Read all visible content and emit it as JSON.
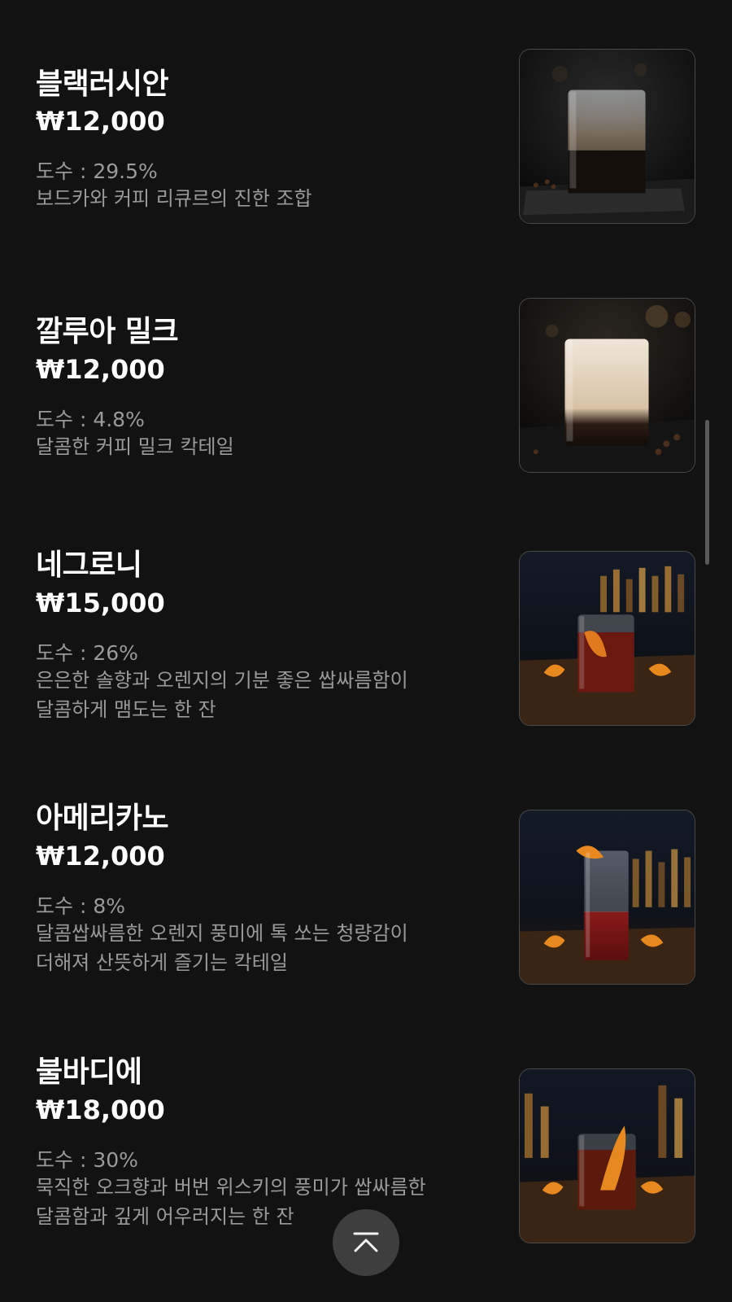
{
  "items": [
    {
      "name": "블랙러시안",
      "price": "₩12,000",
      "abv": "도수 : 29.5%",
      "description": [
        "보드카와 커피 리큐르의 진한 조합"
      ],
      "photo": "black-russian-cocktail-photo"
    },
    {
      "name": "깔루아 밀크",
      "price": "₩12,000",
      "abv": "도수 : 4.8%",
      "description": [
        "달콤한 커피 밀크 칵테일"
      ],
      "photo": "kahlua-milk-cocktail-photo"
    },
    {
      "name": "네그로니",
      "price": "₩15,000",
      "abv": "도수 : 26%",
      "description": [
        "은은한 솔향과 오렌지의 기분 좋은 쌉싸름함이",
        "달콤하게 맴도는 한 잔"
      ],
      "photo": "negroni-cocktail-photo"
    },
    {
      "name": "아메리카노",
      "price": "₩12,000",
      "abv": "도수 : 8%",
      "description": [
        "달콤쌉싸름한 오렌지 풍미에 톡 쏘는 청량감이",
        "더해져 산뜻하게 즐기는 칵테일"
      ],
      "photo": "americano-cocktail-photo"
    },
    {
      "name": "불바디에",
      "price": "₩18,000",
      "abv": "도수 : 30%",
      "description": [
        "묵직한 오크향과 버번 위스키의 풍미가 쌉싸름한",
        "달콤함과 깊게 어우러지는 한 잔"
      ],
      "photo": "boulevardier-cocktail-photo"
    }
  ],
  "scroll_top_button": {
    "icon": "chevron-up-icon"
  },
  "colors": {
    "background": "#121212",
    "name_text": "#ffffff",
    "meta_text": "#9a9a9a",
    "button_bg": "#3e3e3e"
  }
}
